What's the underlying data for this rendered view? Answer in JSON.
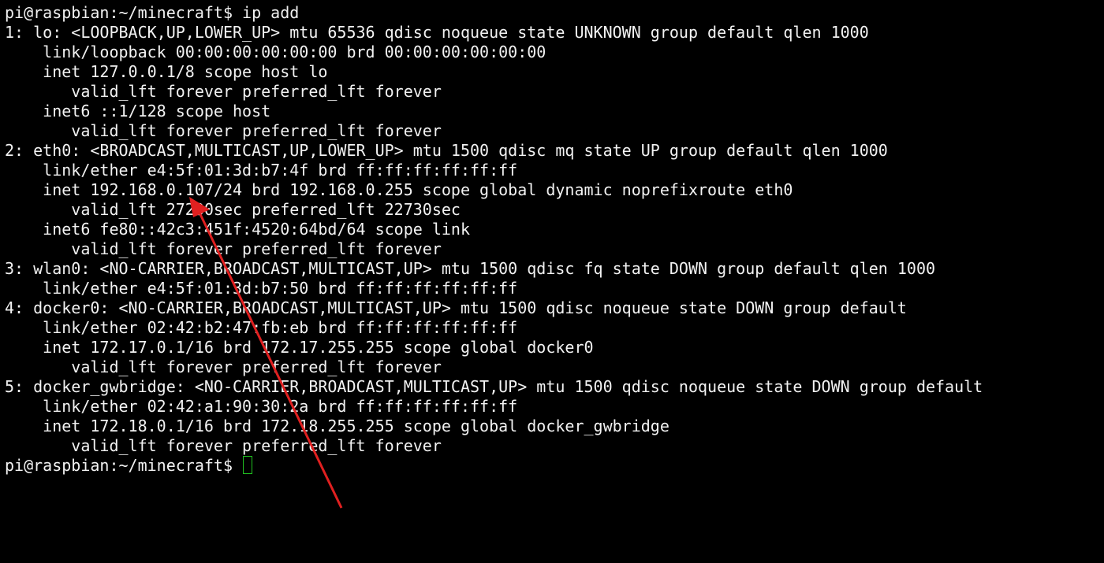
{
  "terminal": {
    "lines": [
      "pi@raspbian:~/minecraft$ ip add",
      "1: lo: <LOOPBACK,UP,LOWER_UP> mtu 65536 qdisc noqueue state UNKNOWN group default qlen 1000",
      "    link/loopback 00:00:00:00:00:00 brd 00:00:00:00:00:00",
      "    inet 127.0.0.1/8 scope host lo",
      "       valid_lft forever preferred_lft forever",
      "    inet6 ::1/128 scope host",
      "       valid_lft forever preferred_lft forever",
      "2: eth0: <BROADCAST,MULTICAST,UP,LOWER_UP> mtu 1500 qdisc mq state UP group default qlen 1000",
      "    link/ether e4:5f:01:3d:b7:4f brd ff:ff:ff:ff:ff:ff",
      "    inet 192.168.0.107/24 brd 192.168.0.255 scope global dynamic noprefixroute eth0",
      "       valid_lft 27230sec preferred_lft 22730sec",
      "    inet6 fe80::42c3:451f:4520:64bd/64 scope link",
      "       valid_lft forever preferred_lft forever",
      "3: wlan0: <NO-CARRIER,BROADCAST,MULTICAST,UP> mtu 1500 qdisc fq state DOWN group default qlen 1000",
      "    link/ether e4:5f:01:3d:b7:50 brd ff:ff:ff:ff:ff:ff",
      "4: docker0: <NO-CARRIER,BROADCAST,MULTICAST,UP> mtu 1500 qdisc noqueue state DOWN group default",
      "    link/ether 02:42:b2:47:fb:eb brd ff:ff:ff:ff:ff:ff",
      "    inet 172.17.0.1/16 brd 172.17.255.255 scope global docker0",
      "       valid_lft forever preferred_lft forever",
      "5: docker_gwbridge: <NO-CARRIER,BROADCAST,MULTICAST,UP> mtu 1500 qdisc noqueue state DOWN group default",
      "    link/ether 02:42:a1:90:30:2a brd ff:ff:ff:ff:ff:ff",
      "    inet 172.18.0.1/16 brd 172.18.255.255 scope global docker_gwbridge",
      "       valid_lft forever preferred_lft forever"
    ],
    "prompt": "pi@raspbian:~/minecraft$ ",
    "colors": {
      "background": "#000000",
      "foreground": "#f2f2f2",
      "cursor": "#20c020",
      "annotation_arrow": "#e02020"
    }
  }
}
